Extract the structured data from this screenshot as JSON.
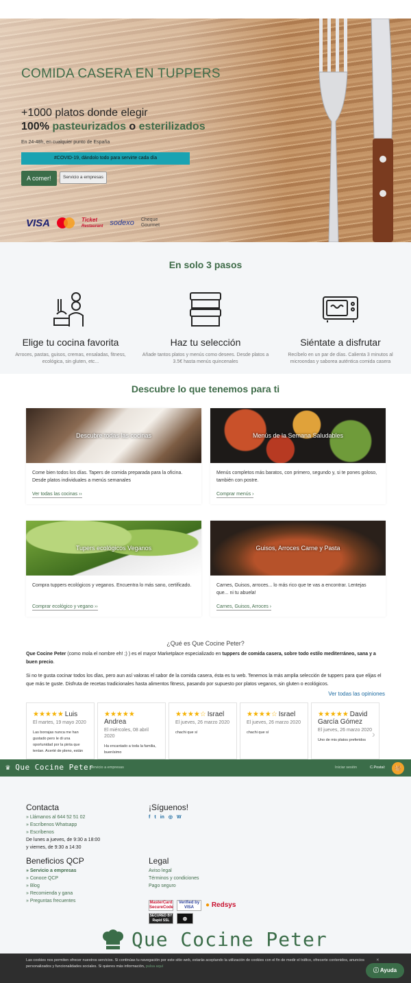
{
  "hero": {
    "title": "COMIDA CASERA EN TUPPERS",
    "sub1": "+1000 platos donde elegir",
    "sub2_prefix": "100%",
    "sub2_a": "pasteurizados",
    "sub2_o": "o",
    "sub2_b": "esterilizados",
    "delivery": "En 24-48h, en cualquier punto de España",
    "covid": "#COVID-19, dándolo todo para servirte cada día",
    "cta_eat": "A comer!",
    "cta_business": "Servicio a empresas",
    "payments": {
      "visa": "VISA",
      "mastercard": "MasterCard",
      "ticket1": "Ticket",
      "ticket2": "Restaurant",
      "sodexo": "sodexo",
      "cheque1": "Cheque",
      "cheque2": "Gourmet"
    }
  },
  "steps": {
    "title": "En solo 3 pasos",
    "items": [
      {
        "title": "Elige tu cocina favorita",
        "text": "Arroces, pastas, guisos, cremas, ensaladas, fitness, ecológica, sin gluten, etc...",
        "icon": "chef-cooking-icon"
      },
      {
        "title": "Haz tu selección",
        "text": "Añade tantos platos y menús como desees. Desde platos a 3.5€ hasta menús quincenales",
        "icon": "stacked-tuppers-icon"
      },
      {
        "title": "Siéntate a disfrutar",
        "text": "Recíbelo en un par de días. Calienta 3 minutos al microondas y saborea auténtica comida casera",
        "icon": "microwave-icon"
      }
    ]
  },
  "discover": {
    "title": "Descubre lo que tenemos para ti",
    "cards": [
      {
        "overlay": "Descubre todas las cocinas",
        "text": "Come bien todos los días. Tapers de comida preparada para la oficina. Desde platos individuales a menús semanales",
        "link": "Ver todas las cocinas ››"
      },
      {
        "overlay": "Menús de la Semana Saludables",
        "text": "Menús completos más baratos, con primero, segundo y, si te pones goloso, también con postre.",
        "link": "Comprar menús ›"
      },
      {
        "overlay": "Tupers ecológicos Veganos",
        "text": "Compra tuppers ecológicos y veganos. Encuentra lo más sano, certificado.",
        "link": "Comprar ecológico y vegano ››"
      },
      {
        "overlay": "Guisos, Arroces Carne y Pasta",
        "text": "Carnes, Guisos, arroces... lo más rico que te vas a encontrar. Lentejas que... ni tu abuela!",
        "link": "Carnes, Guisos, Arroces ›"
      }
    ]
  },
  "about": {
    "title": "¿Qué es Que Cocine Peter?",
    "p1_brand": "Que Cocine Peter",
    "p1_mid": " (como mola el nombre eh! ;) ) es el mayor Marketplace especializado en ",
    "p1_bold": "tuppers de comida casera, sobre todo estilo mediterráneo, sana y a buen precio",
    "p1_end": ".",
    "p2": "Si no te gusta cocinar todos los días, pero aun así valoras el sabor de la comida casera, ésta es tu web. Tenemos la más amplia selección de tuppers para que elijas el que más te guste. Disfruta de recetas tradicionales hasta alimentos fitness, pasando por supuesto por platos veganos, sin gluten o ecológicos.",
    "all_reviews": "Ver todas las opiniones"
  },
  "reviews": [
    {
      "stars": "★★★★★",
      "name": "Luis",
      "date": "El martes, 19 mayo 2020",
      "text": "Las borrajas nunca me han gustado pero le di una oportunidad por la pinta que tenían. Acerté de pleno, están"
    },
    {
      "stars": "★★★★★",
      "name": "Andrea",
      "date": "El miércoles, 08 abril 2020",
      "text": "Ha encantado a toda la familia, buenísimo"
    },
    {
      "stars": "★★★★☆",
      "name": "Israel",
      "date": "El jueves, 26 marzo 2020",
      "text": "chachi que sí"
    },
    {
      "stars": "★★★★☆",
      "name": "Israel",
      "date": "El jueves, 26 marzo 2020",
      "text": "chachi que sí"
    },
    {
      "stars": "★★★★★",
      "name": "David García Gómez",
      "date": "El jueves, 26 marzo 2020",
      "text": "Uno de mis platos preferidos"
    }
  ],
  "bar": {
    "logo": "Que Cocine Peter",
    "business": "Servicio a empresas",
    "login": "Iniciar sesión",
    "postal": "C.Postal:"
  },
  "footer": {
    "contact_title": "Contacta",
    "call": "» Llámanos al 644 52 51 02",
    "whatsapp": "» Escríbenos Whatsapp",
    "write": "» Escríbenos",
    "hours1": "De lunes a jueves, de 9:30 a 18:00",
    "hours2": "y viernes, de 9:30 a 14:30",
    "follow_title": "¡Síguenos!",
    "social": [
      "f",
      "t",
      "in",
      "◎",
      "W"
    ],
    "benefits_title": "Beneficios QCP",
    "benefits": [
      "» Servicio a empresas",
      "» Conoce QCP",
      "» Blog",
      "» Recomienda y gana",
      "» Preguntas frecuentes"
    ],
    "legal_title": "Legal",
    "legal": [
      "Aviso legal",
      "Términos y condiciones",
      "Pago seguro"
    ],
    "seals": {
      "mc": "MasterCard SecureCode",
      "vbv1": "Verified by",
      "vbv2": "VISA",
      "redsys": "Redsys",
      "secured": "SECURED BY Rapid SSL"
    },
    "brand": "Que Cocine Peter"
  },
  "cookies": {
    "text": "Las cookies nos permiten ofrecer nuestros servicios. Si continúas tu navegación por este sitio web, estarás aceptando la utilización de cookies con el fin de medir el tráfico, ofrecerte contenidos, anuncios personalizados y funcionalidades sociales. Si quieres más información, ",
    "more": "pulsa aquí",
    "help": "Ayuda"
  },
  "colors": {
    "brand_green": "#3b6d49",
    "accent_teal": "#1aa3b2",
    "star": "#f5b100"
  }
}
